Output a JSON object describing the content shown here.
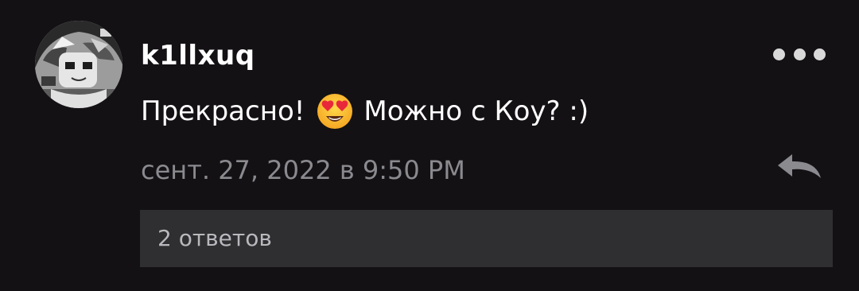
{
  "comment": {
    "username": "k1llxuq",
    "message_before_emoji": "Прекрасно!",
    "emoji_icon": "heart-eyes-emoji-icon",
    "message_after_emoji": "Можно с Коу? :)",
    "timestamp": "сент. 27, 2022 в 9:50 PM",
    "replies_label": "2 ответов",
    "more_icon": "more-dots-icon",
    "reply_icon": "reply-arrow-icon"
  },
  "colors": {
    "background": "#141114",
    "text_primary": "#ffffff",
    "text_secondary": "#8a8a8f",
    "replies_bar_bg": "#2f2e31",
    "icon": "#d9d9d9"
  }
}
